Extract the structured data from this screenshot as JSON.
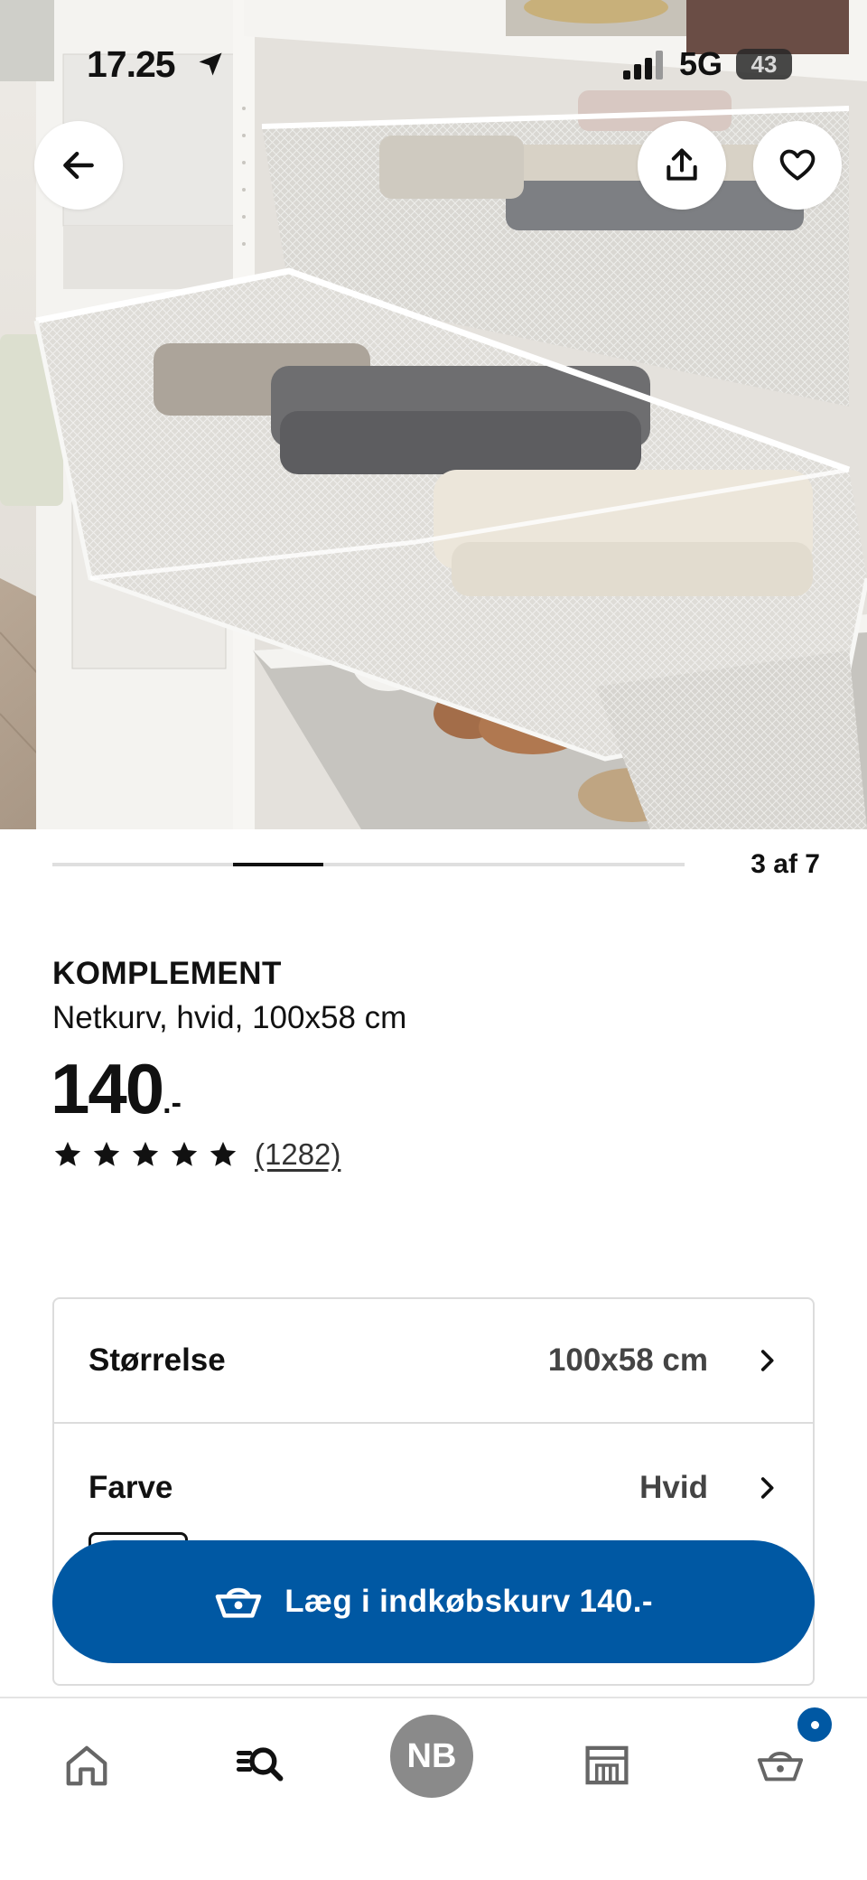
{
  "status_bar": {
    "time": "17.25",
    "network": "5G",
    "battery": "43"
  },
  "header_actions": {
    "back_icon": "arrow-left-icon",
    "share_icon": "share-icon",
    "favorite_icon": "heart-icon"
  },
  "carousel": {
    "current": 3,
    "total": 7,
    "indicator": "3 af 7"
  },
  "product": {
    "name": "KOMPLEMENT",
    "description": "Netkurv, hvid, 100x58 cm",
    "price": "140",
    "price_suffix": ".-",
    "rating": 5,
    "reviews": "(1282)"
  },
  "options": [
    {
      "label": "Størrelse",
      "value": "100x58 cm"
    },
    {
      "label": "Farve",
      "value": "Hvid"
    }
  ],
  "cart_button": {
    "label": "Læg i indkøbskurv 140.-",
    "icon": "basket-icon"
  },
  "bottom_nav": {
    "items": [
      "home-icon",
      "search-icon",
      "profile-avatar",
      "stores-icon",
      "cart-icon"
    ],
    "profile_initials": "NB"
  },
  "colors": {
    "brand_blue": "#0058a3",
    "text": "#111111",
    "avatar_grey": "#8a8a8a"
  }
}
